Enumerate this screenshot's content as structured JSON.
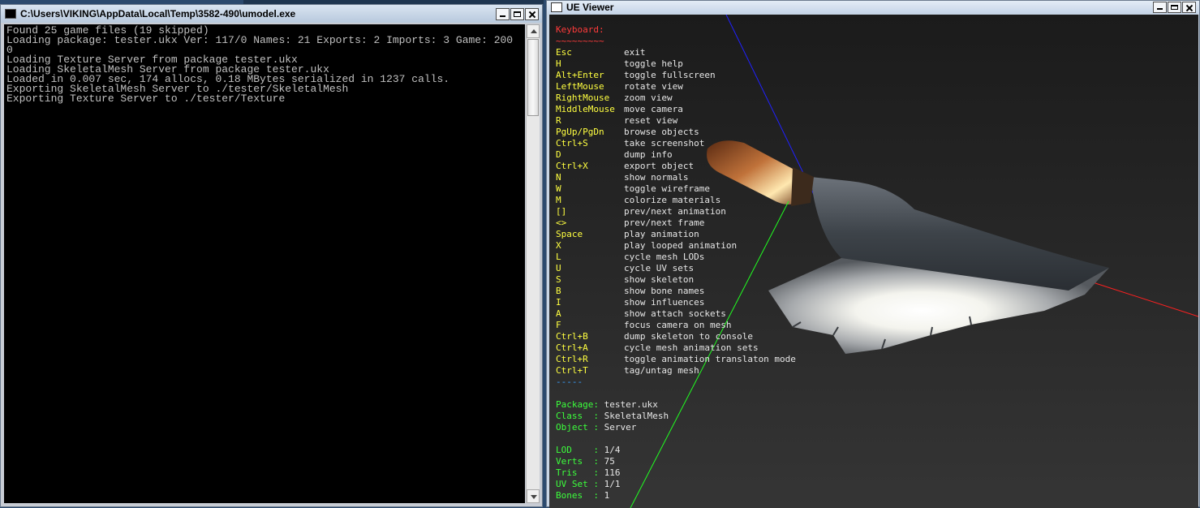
{
  "console": {
    "title": "C:\\Users\\VIKING\\AppData\\Local\\Temp\\3582-490\\umodel.exe",
    "lines": [
      "Found 25 game files (19 skipped)",
      "Loading package: tester.ukx Ver: 117/0 Names: 21 Exports: 2 Imports: 3 Game: 200",
      "0",
      "Loading Texture Server from package tester.ukx",
      "Loading SkeletalMesh Server from package tester.ukx",
      "Loaded in 0.007 sec, 174 allocs, 0.18 MBytes serialized in 1237 calls.",
      "Exporting SkeletalMesh Server to ./tester/SkeletalMesh",
      "Exporting Texture Server to ./tester/Texture"
    ]
  },
  "viewer": {
    "title": "UE Viewer",
    "keyboard_title": "Keyboard:",
    "keyboard_underline": "~~~~~~~~~",
    "shortcuts": [
      {
        "key": "Esc",
        "desc": "exit"
      },
      {
        "key": "H",
        "desc": "toggle help"
      },
      {
        "key": "Alt+Enter",
        "desc": "toggle fullscreen"
      },
      {
        "key": "LeftMouse",
        "desc": "rotate view"
      },
      {
        "key": "RightMouse",
        "desc": "zoom view"
      },
      {
        "key": "MiddleMouse",
        "desc": "move camera"
      },
      {
        "key": "R",
        "desc": "reset view"
      },
      {
        "key": "PgUp/PgDn",
        "desc": "browse objects"
      },
      {
        "key": "Ctrl+S",
        "desc": "take screenshot"
      },
      {
        "key": "D",
        "desc": "dump info"
      },
      {
        "key": "Ctrl+X",
        "desc": "export object"
      },
      {
        "key": "N",
        "desc": "show normals"
      },
      {
        "key": "W",
        "desc": "toggle wireframe"
      },
      {
        "key": "M",
        "desc": "colorize materials"
      },
      {
        "key": "[]",
        "desc": "prev/next animation"
      },
      {
        "key": "<>",
        "desc": "prev/next frame"
      },
      {
        "key": "Space",
        "desc": "play animation"
      },
      {
        "key": "X",
        "desc": "play looped animation"
      },
      {
        "key": "L",
        "desc": "cycle mesh LODs"
      },
      {
        "key": "U",
        "desc": "cycle UV sets"
      },
      {
        "key": "S",
        "desc": "show skeleton"
      },
      {
        "key": "B",
        "desc": "show bone names"
      },
      {
        "key": "I",
        "desc": "show influences"
      },
      {
        "key": "A",
        "desc": "show attach sockets"
      },
      {
        "key": "F",
        "desc": "focus camera on mesh"
      },
      {
        "key": "Ctrl+B",
        "desc": "dump skeleton to console"
      },
      {
        "key": "Ctrl+A",
        "desc": "cycle mesh animation sets"
      },
      {
        "key": "Ctrl+R",
        "desc": "toggle animation translaton mode"
      },
      {
        "key": "Ctrl+T",
        "desc": "tag/untag mesh"
      }
    ],
    "separator": "-----",
    "object_info": [
      {
        "label": "Package:",
        "value": "tester.ukx"
      },
      {
        "label": "Class  :",
        "value": "SkeletalMesh"
      },
      {
        "label": "Object :",
        "value": "Server"
      }
    ],
    "mesh_info": [
      {
        "label": "LOD    :",
        "value": "1/4"
      },
      {
        "label": "Verts  :",
        "value": "75"
      },
      {
        "label": "Tris   :",
        "value": "116"
      },
      {
        "label": "UV Set :",
        "value": "1/1"
      },
      {
        "label": "Bones  :",
        "value": "1"
      }
    ],
    "colors": {
      "keyboard_title": "#ff3b3b",
      "key": "#ffff40",
      "desc": "#e6e6e6",
      "separator": "#3aa0ff",
      "info_label": "#3cff3c",
      "axis_x": "#ff2020",
      "axis_y": "#20ff20",
      "axis_z": "#2020ff"
    }
  }
}
